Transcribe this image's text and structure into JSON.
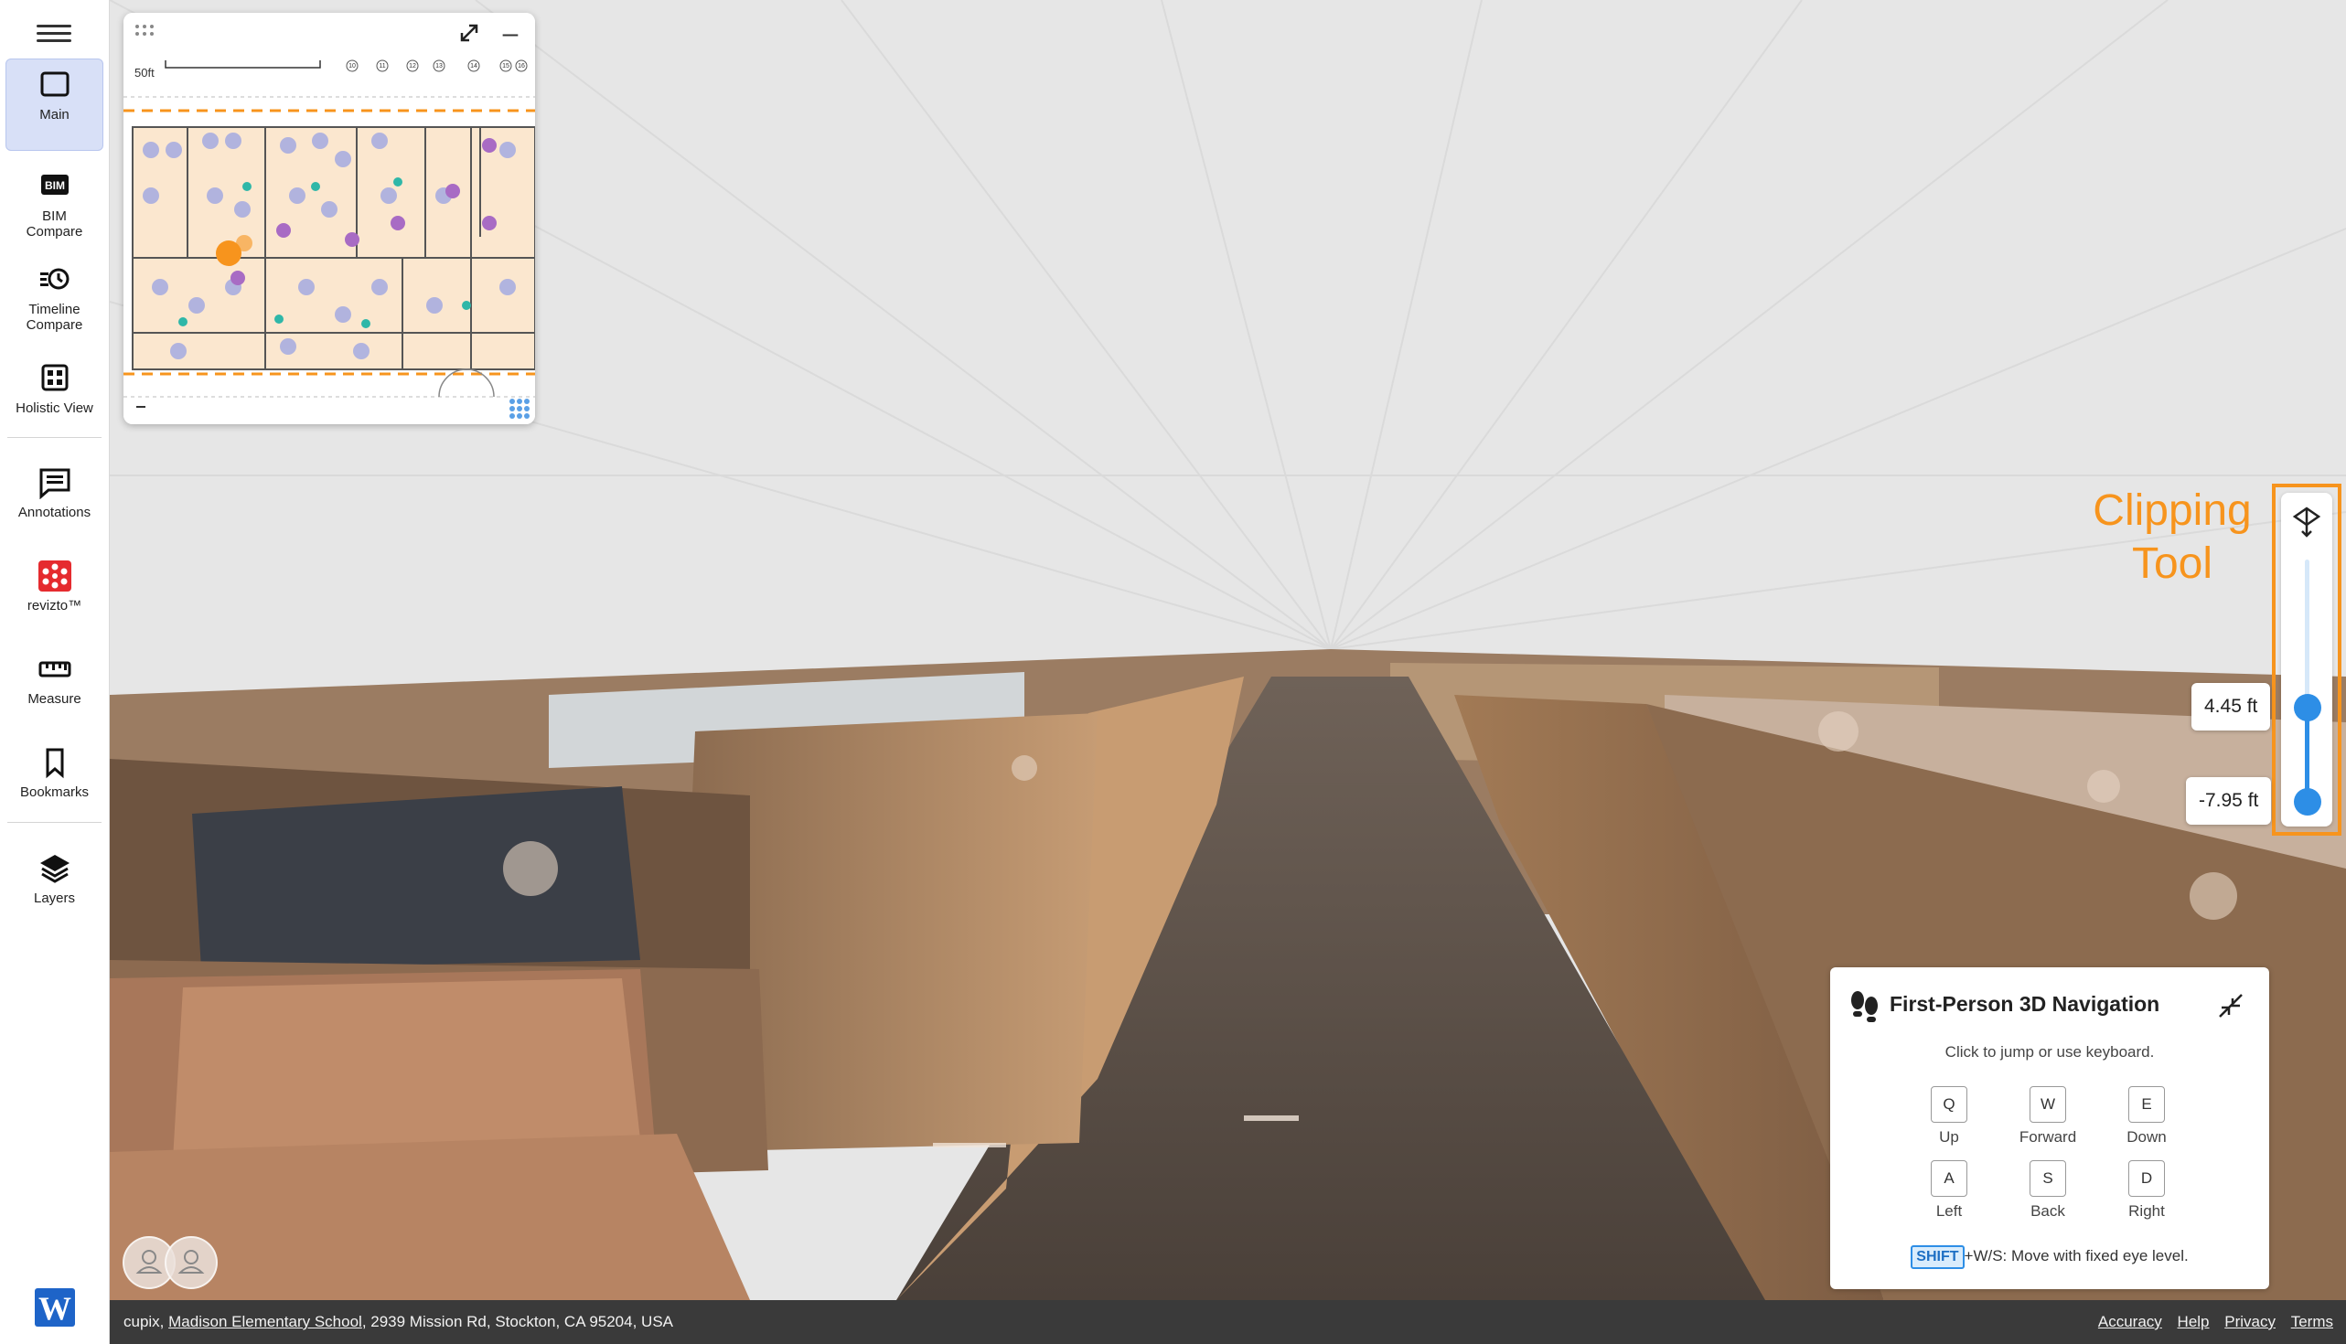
{
  "sidebar": {
    "items": [
      {
        "label": "Main",
        "icon": "square-icon",
        "active": true
      },
      {
        "label": "BIM\nCompare",
        "icon": "bim-icon",
        "badge": "BIM"
      },
      {
        "label": "Timeline\nCompare",
        "icon": "history-icon"
      },
      {
        "label": "Holistic View",
        "icon": "grid-icon"
      },
      {
        "label": "Annotations",
        "icon": "comment-icon"
      },
      {
        "label": "revizto™",
        "icon": "revizto-icon"
      },
      {
        "label": "Measure",
        "icon": "ruler-icon"
      },
      {
        "label": "Bookmarks",
        "icon": "bookmark-icon"
      },
      {
        "label": "Layers",
        "icon": "layers-icon"
      }
    ],
    "logo_letter": "W"
  },
  "minimap": {
    "scale_label": "50ft",
    "grid_labels": [
      "10",
      "11",
      "12",
      "13",
      "14",
      "15",
      "16"
    ],
    "marker_color": "#f7941d"
  },
  "clipping_tool": {
    "label_line1": "Clipping",
    "label_line2": "Tool",
    "upper_value": "4.45 ft",
    "lower_value": "-7.95 ft",
    "accent_color": "#f7941d",
    "slider_color": "#2d8ee6"
  },
  "navigation": {
    "title": "First-Person 3D Navigation",
    "hint": "Click to jump or use keyboard.",
    "keys": [
      {
        "key": "Q",
        "label": "Up"
      },
      {
        "key": "W",
        "label": "Forward"
      },
      {
        "key": "E",
        "label": "Down"
      },
      {
        "key": "A",
        "label": "Left"
      },
      {
        "key": "S",
        "label": "Back"
      },
      {
        "key": "D",
        "label": "Right"
      }
    ],
    "shift_key": "SHIFT",
    "shift_note": "+W/S: Move with fixed eye level."
  },
  "footer": {
    "prefix": "cupix, ",
    "site_link": "Madison Elementary School",
    "address": ", 2939 Mission Rd, Stockton, CA 95204, USA",
    "links": [
      "Accuracy",
      "Help",
      "Privacy",
      "Terms"
    ]
  }
}
